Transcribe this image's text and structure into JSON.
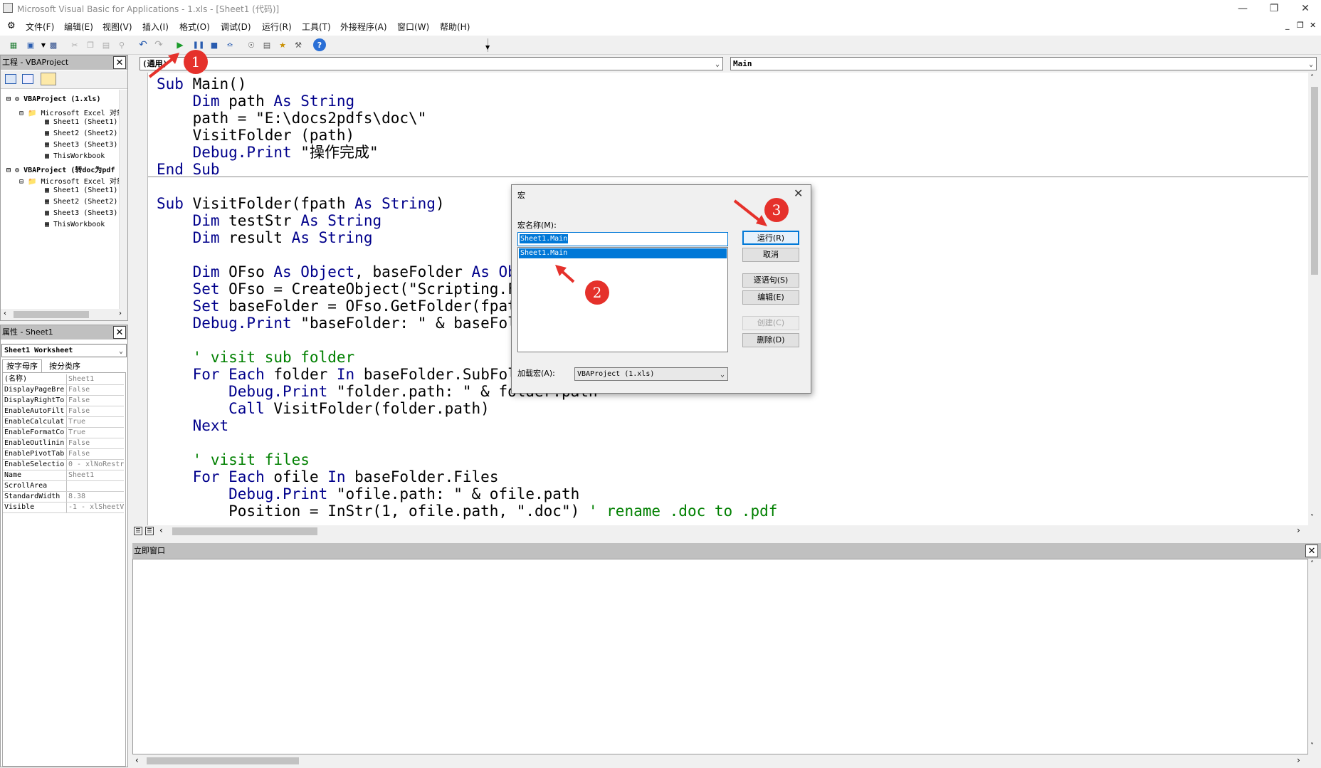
{
  "window": {
    "title": "Microsoft Visual Basic for Applications - 1.xls - [Sheet1 (代码)]"
  },
  "menu": [
    "文件(F)",
    "编辑(E)",
    "视图(V)",
    "插入(I)",
    "格式(O)",
    "调试(D)",
    "运行(R)",
    "工具(T)",
    "外接程序(A)",
    "窗口(W)",
    "帮助(H)"
  ],
  "project_pane": {
    "title": "工程 - VBAProject",
    "tree": [
      {
        "label": "VBAProject (1.xls)",
        "level": 0,
        "bold": true
      },
      {
        "label": "Microsoft Excel 对象",
        "level": 1
      },
      {
        "label": "Sheet1 (Sheet1)",
        "level": 2
      },
      {
        "label": "Sheet2 (Sheet2)",
        "level": 2
      },
      {
        "label": "Sheet3 (Sheet3)",
        "level": 2
      },
      {
        "label": "ThisWorkbook",
        "level": 2
      },
      {
        "label": "VBAProject (转doc为pdf",
        "level": 0,
        "bold": true
      },
      {
        "label": "Microsoft Excel 对象",
        "level": 1
      },
      {
        "label": "Sheet1 (Sheet1)",
        "level": 2
      },
      {
        "label": "Sheet2 (Sheet2)",
        "level": 2
      },
      {
        "label": "Sheet3 (Sheet3)",
        "level": 2
      },
      {
        "label": "ThisWorkbook",
        "level": 2
      }
    ]
  },
  "props_pane": {
    "title": "属性 - Sheet1",
    "object": "Sheet1 Worksheet",
    "tabs": [
      "按字母序",
      "按分类序"
    ],
    "rows": [
      {
        "k": "(名称)",
        "v": "Sheet1"
      },
      {
        "k": "DisplayPageBre",
        "v": "False"
      },
      {
        "k": "DisplayRightTo",
        "v": "False"
      },
      {
        "k": "EnableAutoFilt",
        "v": "False"
      },
      {
        "k": "EnableCalculat",
        "v": "True"
      },
      {
        "k": "EnableFormatCo",
        "v": "True"
      },
      {
        "k": "EnableOutlinin",
        "v": "False"
      },
      {
        "k": "EnablePivotTab",
        "v": "False"
      },
      {
        "k": "EnableSelectio",
        "v": "0 - xlNoRestr"
      },
      {
        "k": "Name",
        "v": "Sheet1"
      },
      {
        "k": "ScrollArea",
        "v": ""
      },
      {
        "k": "StandardWidth",
        "v": "8.38"
      },
      {
        "k": "Visible",
        "v": "-1 - xlSheetV"
      }
    ]
  },
  "code_window": {
    "object_combo": "(通用)",
    "proc_combo": "Main",
    "lines": [
      [
        {
          "t": "Sub ",
          "c": "kw"
        },
        {
          "t": "Main()",
          "c": ""
        }
      ],
      [
        {
          "t": "    Dim ",
          "c": "kw"
        },
        {
          "t": "path ",
          "c": ""
        },
        {
          "t": "As String",
          "c": "kw"
        }
      ],
      [
        {
          "t": "    path = \"E:\\docs2pdfs\\doc\\\"",
          "c": ""
        }
      ],
      [
        {
          "t": "    VisitFolder (path)",
          "c": ""
        }
      ],
      [
        {
          "t": "    Debug.Print ",
          "c": "kw"
        },
        {
          "t": "\"操作完成\"",
          "c": ""
        }
      ],
      [
        {
          "t": "End Sub",
          "c": "kw"
        }
      ],
      [],
      [
        {
          "t": "Sub ",
          "c": "kw"
        },
        {
          "t": "VisitFolder(fpath ",
          "c": ""
        },
        {
          "t": "As String",
          "c": "kw"
        },
        {
          "t": ")",
          "c": ""
        }
      ],
      [
        {
          "t": "    Dim ",
          "c": "kw"
        },
        {
          "t": "testStr ",
          "c": ""
        },
        {
          "t": "As String",
          "c": "kw"
        }
      ],
      [
        {
          "t": "    Dim ",
          "c": "kw"
        },
        {
          "t": "result ",
          "c": ""
        },
        {
          "t": "As String",
          "c": "kw"
        }
      ],
      [],
      [
        {
          "t": "    Dim ",
          "c": "kw"
        },
        {
          "t": "OFso ",
          "c": ""
        },
        {
          "t": "As Object",
          "c": "kw"
        },
        {
          "t": ", baseFolder ",
          "c": ""
        },
        {
          "t": "As Obje",
          "c": "kw"
        }
      ],
      [
        {
          "t": "    Set ",
          "c": "kw"
        },
        {
          "t": "OFso = CreateObject(\"Scripting.Fi",
          "c": ""
        }
      ],
      [
        {
          "t": "    Set ",
          "c": "kw"
        },
        {
          "t": "baseFolder = OFso.GetFolder(fpath)",
          "c": ""
        }
      ],
      [
        {
          "t": "    Debug.Print ",
          "c": "kw"
        },
        {
          "t": "\"baseFolder: \" & baseFolde",
          "c": ""
        }
      ],
      [],
      [
        {
          "t": "    ' visit sub folder",
          "c": "cm"
        }
      ],
      [
        {
          "t": "    For Each ",
          "c": "kw"
        },
        {
          "t": "folder ",
          "c": ""
        },
        {
          "t": "In ",
          "c": "kw"
        },
        {
          "t": "baseFolder.SubFolde",
          "c": ""
        }
      ],
      [
        {
          "t": "        Debug.Print ",
          "c": "kw"
        },
        {
          "t": "\"folder.path: \" & folder.path",
          "c": ""
        }
      ],
      [
        {
          "t": "        Call ",
          "c": "kw"
        },
        {
          "t": "VisitFolder(folder.path)",
          "c": ""
        }
      ],
      [
        {
          "t": "    Next",
          "c": "kw"
        }
      ],
      [],
      [
        {
          "t": "    ' visit files",
          "c": "cm"
        }
      ],
      [
        {
          "t": "    For Each ",
          "c": "kw"
        },
        {
          "t": "ofile ",
          "c": ""
        },
        {
          "t": "In ",
          "c": "kw"
        },
        {
          "t": "baseFolder.Files",
          "c": ""
        }
      ],
      [
        {
          "t": "        Debug.Print ",
          "c": "kw"
        },
        {
          "t": "\"ofile.path: \" & ofile.path",
          "c": ""
        }
      ],
      [
        {
          "t": "        Position = InStr(1, ofile.path, \".doc\") ",
          "c": ""
        },
        {
          "t": "' rename .doc to .pdf",
          "c": "cm"
        }
      ]
    ]
  },
  "immediate": {
    "title": "立即窗口"
  },
  "dialog": {
    "title": "宏",
    "name_label": "宏名称(M):",
    "name_value": "Sheet1.Main",
    "list": [
      "Sheet1.Main"
    ],
    "buttons": {
      "run": "运行(R)",
      "cancel": "取消",
      "step": "逐语句(S)",
      "edit": "编辑(E)",
      "create": "创建(C)",
      "delete": "删除(D)"
    },
    "macros_in_label": "加载宏(A):",
    "macros_in_value": "VBAProject (1.xls)"
  },
  "annotations": [
    "1",
    "2",
    "3"
  ],
  "colors": {
    "keyword": "#00008b",
    "comment": "#008000",
    "highlight": "#0078d7",
    "badge": "#e5312b"
  }
}
